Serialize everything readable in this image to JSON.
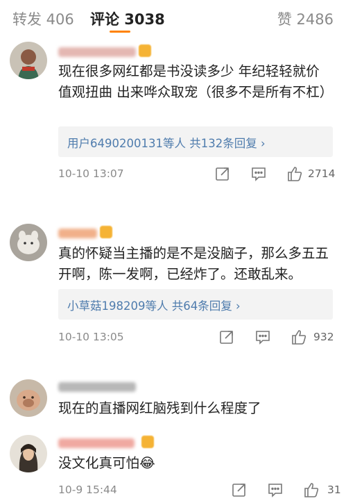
{
  "tabs": {
    "repost": "转发 406",
    "comment": "评论 3038",
    "like": "赞 2486"
  },
  "colors": {
    "accent": "#ff8200",
    "link": "#4f7cad",
    "meta": "#8a8a8a"
  },
  "comments": [
    {
      "text": "现在很多网红都是书没读多少 年纪轻轻就价值观扭曲 出来哗众取宠（很多不是所有不杠）",
      "replies": "用户6490200131等人 共132条回复 ›",
      "time": "10-10 13:07",
      "likes": "2714"
    },
    {
      "text": "真的怀疑当主播的是不是没脑子，那么多五五开啊，陈一发啊，已经炸了。还敢乱来。",
      "replies": "小草菇198209等人 共64条回复 ›",
      "time": "10-10 13:05",
      "likes": "932"
    },
    {
      "text": "现在的直播网红脑残到什么程度了"
    },
    {
      "text": "没文化真可怕😂",
      "time": "10-9 15:44",
      "likes": "31"
    }
  ]
}
